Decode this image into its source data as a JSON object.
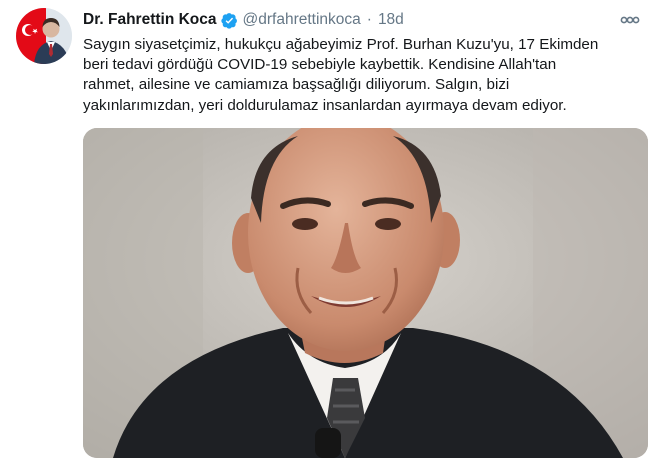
{
  "tweet": {
    "author_name": "Dr. Fahrettin Koca",
    "handle": "@drfahrettinkoca",
    "separator": "·",
    "time": "18d",
    "text_lines": [
      "Saygın siyasetçimiz, hukukçu ağabeyimiz Prof. Burhan Kuzu'yu, 17 Ekimden",
      "beri tedavi gördüğü COVID-19 sebebiyle kaybettik. Kendisine Allah'tan",
      "rahmet, ailesine ve camiamıza başsağlığı diliyorum. Salgın, bizi",
      "yakınlarımızdan, yeri doldurulamaz insanlardan ayırmaya devam ediyor."
    ]
  },
  "icons": {
    "verified": "verified-badge-icon",
    "more": "more-options-icon"
  },
  "colors": {
    "verified": "#1da1f2",
    "secondary_text": "#657786",
    "primary_text": "#14171a",
    "avatar_flag": "#e30a17"
  }
}
